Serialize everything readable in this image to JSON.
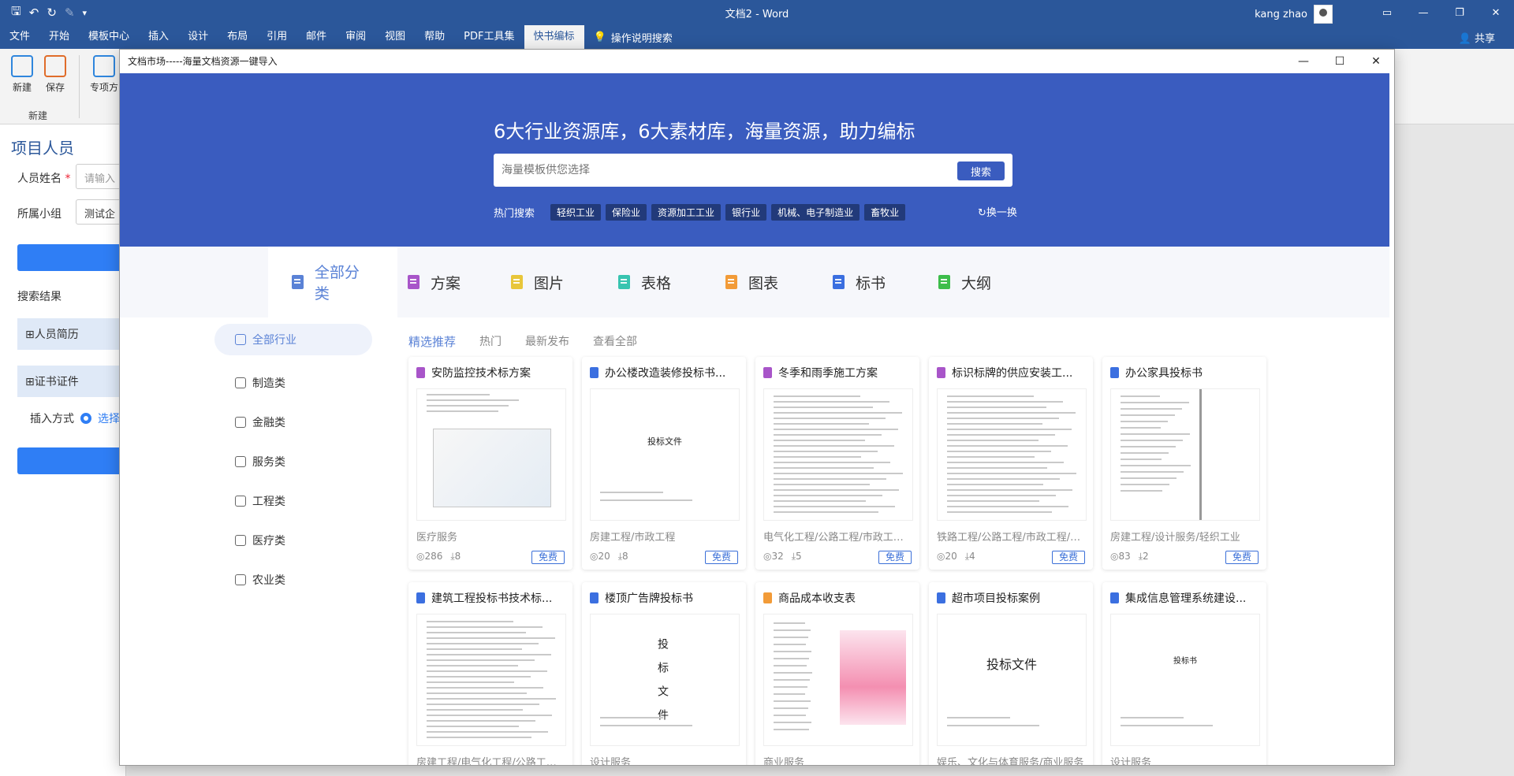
{
  "window": {
    "title": "文档2 - Word",
    "user": "kang zhao",
    "share": "共享"
  },
  "menu": {
    "items": [
      "文件",
      "开始",
      "模板中心",
      "插入",
      "设计",
      "布局",
      "引用",
      "邮件",
      "审阅",
      "视图",
      "帮助",
      "PDF工具集",
      "快书编标"
    ],
    "active_index": 12,
    "tell_me": "操作说明搜索"
  },
  "ribbon": {
    "new_label": "新建",
    "save_label": "保存",
    "special_label": "专项方",
    "group_label": "新建"
  },
  "taskpane": {
    "title": "项目人员",
    "name_label": "人员姓名",
    "name_required": "*",
    "name_placeholder": "请输入",
    "group_label": "所属小组",
    "group_value": "测试企",
    "results_label": "搜索结果",
    "group1": "⊞人员简历",
    "group2": "⊞证书证件",
    "insert_label": "插入方式",
    "insert_option": "选择"
  },
  "dialog": {
    "title": "文档市场-----海量文档资源一键导入",
    "headline": "6大行业资源库，6大素材库，海量资源，助力编标",
    "search_placeholder": "海量模板供您选择",
    "search_button": "搜索",
    "hot_label": "热门搜索",
    "hot_tags": [
      "轻织工业",
      "保险业",
      "资源加工工业",
      "银行业",
      "机械、电子制造业",
      "畜牧业"
    ],
    "refresh": "换一换",
    "refresh_icon": "↻"
  },
  "categories": [
    {
      "label": "全部分类",
      "color": "#5a82d6"
    },
    {
      "label": "方案",
      "color": "#a855c9"
    },
    {
      "label": "图片",
      "color": "#e8c63a"
    },
    {
      "label": "表格",
      "color": "#38c4b0"
    },
    {
      "label": "图表",
      "color": "#f29b38"
    },
    {
      "label": "标书",
      "color": "#3b6fe0"
    },
    {
      "label": "大纲",
      "color": "#3dbd4b"
    }
  ],
  "industries": [
    "全部行业",
    "制造类",
    "金融类",
    "服务类",
    "工程类",
    "医疗类",
    "农业类"
  ],
  "tabs": [
    "精选推荐",
    "热门",
    "最新发布",
    "查看全部"
  ],
  "free_label": "免费",
  "cards": [
    {
      "title": "安防监控技术标方案",
      "icon_color": "#a855c9",
      "meta": "医疗服务",
      "views": "◎286",
      "downloads": "⤓8",
      "thumb": "diagram"
    },
    {
      "title": "办公楼改造装修投标书...",
      "icon_color": "#3b6fe0",
      "meta": "房建工程/市政工程",
      "views": "◎20",
      "downloads": "⤓8",
      "thumb": "cover",
      "thumb_text": "投标文件"
    },
    {
      "title": "冬季和雨季施工方案",
      "icon_color": "#a855c9",
      "meta": "电气化工程/公路工程/市政工程/...",
      "views": "◎32",
      "downloads": "⤓5",
      "thumb": "text"
    },
    {
      "title": "标识标牌的供应安装工...",
      "icon_color": "#a855c9",
      "meta": "铁路工程/公路工程/市政工程/房...",
      "views": "◎20",
      "downloads": "⤓4",
      "thumb": "text"
    },
    {
      "title": "办公家具投标书",
      "icon_color": "#3b6fe0",
      "meta": "房建工程/设计服务/轻织工业",
      "views": "◎83",
      "downloads": "⤓2",
      "thumb": "spread"
    },
    {
      "title": "建筑工程投标书技术标...",
      "icon_color": "#3b6fe0",
      "meta": "房建工程/电气化工程/公路工程/...",
      "views": "",
      "downloads": "",
      "thumb": "text"
    },
    {
      "title": "楼顶广告牌投标书",
      "icon_color": "#3b6fe0",
      "meta": "设计服务",
      "views": "",
      "downloads": "",
      "thumb": "vertical",
      "thumb_text": "投标文件"
    },
    {
      "title": "商品成本收支表",
      "icon_color": "#f29b38",
      "meta": "商业服务",
      "views": "",
      "downloads": "",
      "thumb": "chart"
    },
    {
      "title": "超市项目投标案例",
      "icon_color": "#3b6fe0",
      "meta": "娱乐、文化与体育服务/商业服务",
      "views": "",
      "downloads": "",
      "thumb": "cover2",
      "thumb_text": "投标文件"
    },
    {
      "title": "集成信息管理系统建设...",
      "icon_color": "#3b6fe0",
      "meta": "设计服务",
      "views": "",
      "downloads": "",
      "thumb": "cover3",
      "thumb_text": "投标书"
    }
  ]
}
